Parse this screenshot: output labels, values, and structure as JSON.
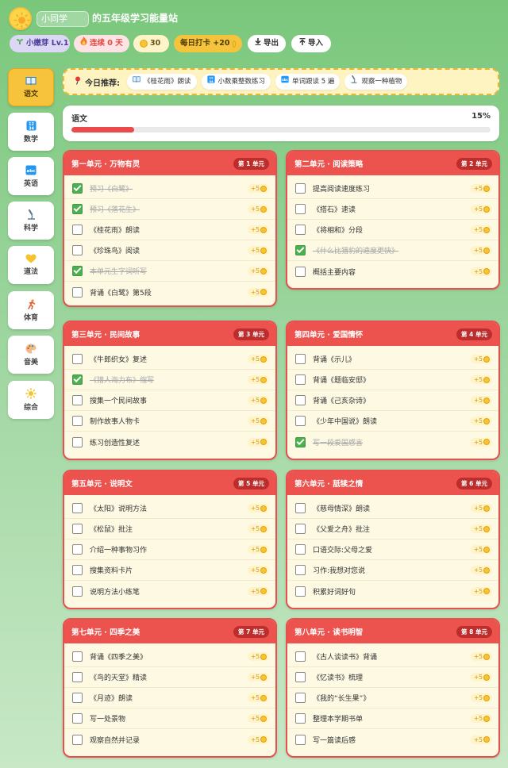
{
  "header": {
    "student_name": "小同学",
    "title": "的五年级学习能量站",
    "level_label": "小嫩芽 Lv.1",
    "streak_label": "连续 0 天",
    "coins": "30",
    "checkin_label": "每日打卡 +20",
    "export_label": "导出",
    "import_label": "导入"
  },
  "subjects": [
    {
      "label": "语文",
      "icon": "book-icon",
      "active": true
    },
    {
      "label": "数学",
      "icon": "numbers-icon",
      "active": false
    },
    {
      "label": "英语",
      "icon": "abc-icon",
      "active": false
    },
    {
      "label": "科学",
      "icon": "microscope-icon",
      "active": false
    },
    {
      "label": "道法",
      "icon": "heart-icon",
      "active": false
    },
    {
      "label": "体育",
      "icon": "runner-icon",
      "active": false
    },
    {
      "label": "音美",
      "icon": "palette-icon",
      "active": false
    },
    {
      "label": "综合",
      "icon": "sun-icon",
      "active": false
    }
  ],
  "recommend": {
    "label": "今日推荐:",
    "items": [
      {
        "text": "《桂花雨》朗读",
        "icon": "book-icon"
      },
      {
        "text": "小数乘整数练习",
        "icon": "numbers-icon"
      },
      {
        "text": "单词跟读 5 遍",
        "icon": "abc-icon"
      },
      {
        "text": "观察一种植物",
        "icon": "microscope-icon"
      }
    ]
  },
  "progress": {
    "subject": "语文",
    "percent_label": "15%",
    "value": 0.15
  },
  "units": [
    {
      "title": "第一单元 · 万物有灵",
      "badge": "第 1 单元",
      "tasks": [
        {
          "label": "预习《白鹭》",
          "done": true,
          "reward": "+5"
        },
        {
          "label": "预习《落花生》",
          "done": true,
          "reward": "+5"
        },
        {
          "label": "《桂花雨》朗读",
          "done": false,
          "reward": "+5"
        },
        {
          "label": "《珍珠鸟》阅读",
          "done": false,
          "reward": "+5"
        },
        {
          "label": "本单元生字词听写",
          "done": true,
          "reward": "+5"
        },
        {
          "label": "背诵《白鹭》第5段",
          "done": false,
          "reward": "+5"
        }
      ]
    },
    {
      "title": "第二单元 · 阅读策略",
      "badge": "第 2 单元",
      "tasks": [
        {
          "label": "提高阅读速度练习",
          "done": false,
          "reward": "+5"
        },
        {
          "label": "《搭石》速读",
          "done": false,
          "reward": "+5"
        },
        {
          "label": "《将相和》分段",
          "done": false,
          "reward": "+5"
        },
        {
          "label": "《什么比猎豹的速度更快》",
          "done": true,
          "reward": "+5"
        },
        {
          "label": "概括主要内容",
          "done": false,
          "reward": "+5"
        }
      ]
    },
    {
      "title": "第三单元 · 民间故事",
      "badge": "第 3 单元",
      "tasks": [
        {
          "label": "《牛郎织女》复述",
          "done": false,
          "reward": "+5"
        },
        {
          "label": "《猎人海力布》缩写",
          "done": true,
          "reward": "+5"
        },
        {
          "label": "搜集一个民间故事",
          "done": false,
          "reward": "+5"
        },
        {
          "label": "制作故事人物卡",
          "done": false,
          "reward": "+5"
        },
        {
          "label": "练习创造性复述",
          "done": false,
          "reward": "+5"
        }
      ]
    },
    {
      "title": "第四单元 · 爱国情怀",
      "badge": "第 4 单元",
      "tasks": [
        {
          "label": "背诵《示儿》",
          "done": false,
          "reward": "+5"
        },
        {
          "label": "背诵《题临安邸》",
          "done": false,
          "reward": "+5"
        },
        {
          "label": "背诵《己亥杂诗》",
          "done": false,
          "reward": "+5"
        },
        {
          "label": "《少年中国说》朗读",
          "done": false,
          "reward": "+5"
        },
        {
          "label": "写一段爱国感言",
          "done": true,
          "reward": "+5"
        }
      ]
    },
    {
      "title": "第五单元 · 说明文",
      "badge": "第 5 单元",
      "tasks": [
        {
          "label": "《太阳》说明方法",
          "done": false,
          "reward": "+5"
        },
        {
          "label": "《松鼠》批注",
          "done": false,
          "reward": "+5"
        },
        {
          "label": "介绍一种事物习作",
          "done": false,
          "reward": "+5"
        },
        {
          "label": "搜集资料卡片",
          "done": false,
          "reward": "+5"
        },
        {
          "label": "说明方法小练笔",
          "done": false,
          "reward": "+5"
        }
      ]
    },
    {
      "title": "第六单元 · 舐犊之情",
      "badge": "第 6 单元",
      "tasks": [
        {
          "label": "《慈母情深》朗读",
          "done": false,
          "reward": "+5"
        },
        {
          "label": "《父爱之舟》批注",
          "done": false,
          "reward": "+5"
        },
        {
          "label": "口语交际:父母之爱",
          "done": false,
          "reward": "+5"
        },
        {
          "label": "习作:我想对您说",
          "done": false,
          "reward": "+5"
        },
        {
          "label": "积累好词好句",
          "done": false,
          "reward": "+5"
        }
      ]
    },
    {
      "title": "第七单元 · 四季之美",
      "badge": "第 7 单元",
      "tasks": [
        {
          "label": "背诵《四季之美》",
          "done": false,
          "reward": "+5"
        },
        {
          "label": "《鸟的天堂》精读",
          "done": false,
          "reward": "+5"
        },
        {
          "label": "《月迹》朗读",
          "done": false,
          "reward": "+5"
        },
        {
          "label": "写一处景物",
          "done": false,
          "reward": "+5"
        },
        {
          "label": "观察自然并记录",
          "done": false,
          "reward": "+5"
        }
      ]
    },
    {
      "title": "第八单元 · 读书明智",
      "badge": "第 8 单元",
      "tasks": [
        {
          "label": "《古人谈读书》背诵",
          "done": false,
          "reward": "+5"
        },
        {
          "label": "《忆读书》梳理",
          "done": false,
          "reward": "+5"
        },
        {
          "label": "《我的“长生果”》",
          "done": false,
          "reward": "+5"
        },
        {
          "label": "整理本学期书单",
          "done": false,
          "reward": "+5"
        },
        {
          "label": "写一篇读后感",
          "done": false,
          "reward": "+5"
        }
      ]
    }
  ]
}
